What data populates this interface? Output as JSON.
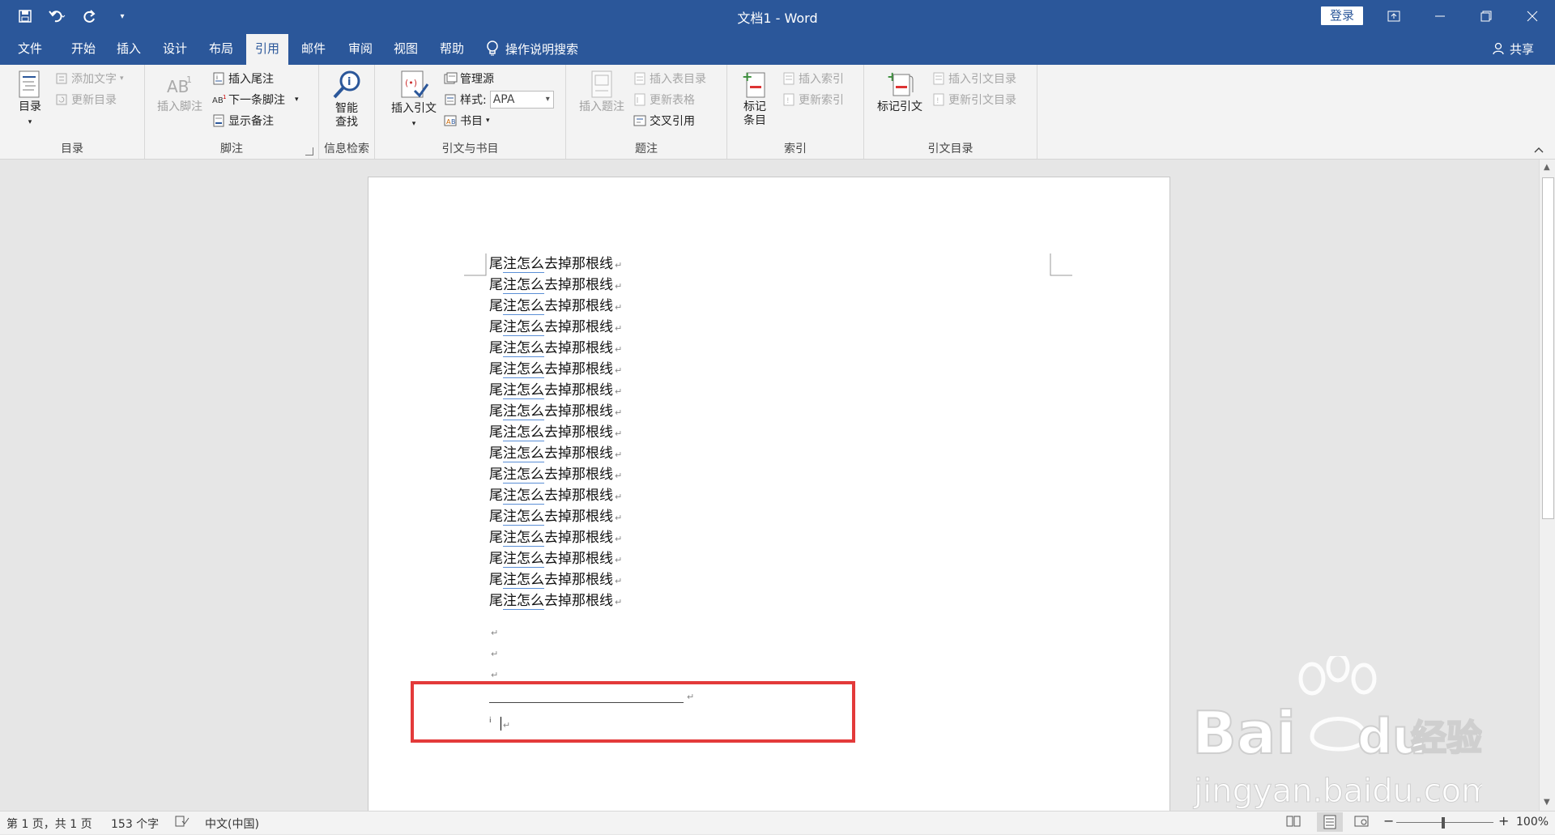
{
  "window": {
    "title": "文档1  -  Word",
    "login": "登录"
  },
  "tabs": [
    {
      "label": "文件"
    },
    {
      "label": "开始"
    },
    {
      "label": "插入"
    },
    {
      "label": "设计"
    },
    {
      "label": "布局"
    },
    {
      "label": "引用"
    },
    {
      "label": "邮件"
    },
    {
      "label": "审阅"
    },
    {
      "label": "视图"
    },
    {
      "label": "帮助"
    }
  ],
  "tab_search": "操作说明搜索",
  "share": "共享",
  "ribbon": {
    "toc": {
      "big": "目录",
      "add_text": "添加文字",
      "update": "更新目录",
      "label": "目录"
    },
    "footnotes": {
      "insert_footnote": "插入脚注",
      "insert_endnote": "插入尾注",
      "next_footnote": "下一条脚注",
      "show_notes": "显示备注",
      "label": "脚注"
    },
    "research": {
      "smart_lookup_1": "智能",
      "smart_lookup_2": "查找",
      "label": "信息检索"
    },
    "citations": {
      "insert_citation": "插入引文",
      "manage_sources": "管理源",
      "style_label": "样式:",
      "style_value": "APA",
      "bibliography": "书目",
      "label": "引文与书目"
    },
    "captions": {
      "insert_caption": "插入题注",
      "insert_table_figures": "插入表目录",
      "update_table": "更新表格",
      "cross_reference": "交叉引用",
      "label": "题注"
    },
    "index": {
      "mark_entry_1": "标记",
      "mark_entry_2": "条目",
      "insert_index": "插入索引",
      "update_index": "更新索引",
      "label": "索引"
    },
    "toa": {
      "mark_citation": "标记引文",
      "insert_toa": "插入引文目录",
      "update_toa": "更新引文目录",
      "label": "引文目录"
    }
  },
  "document": {
    "lines": [
      "尾注怎么去掉那根线",
      "尾注怎么去掉那根线",
      "尾注怎么去掉那根线",
      "尾注怎么去掉那根线",
      "尾注怎么去掉那根线",
      "尾注怎么去掉那根线",
      "尾注怎么去掉那根线",
      "尾注怎么去掉那根线",
      "尾注怎么去掉那根线",
      "尾注怎么去掉那根线",
      "尾注怎么去掉那根线",
      "尾注怎么去掉那根线",
      "尾注怎么去掉那根线",
      "尾注怎么去掉那根线",
      "尾注怎么去掉那根线",
      "尾注怎么去掉那根线",
      "尾注怎么去掉那根线"
    ],
    "line_parts": {
      "a": "尾",
      "b": "注怎么",
      "c": "去掉那根线"
    },
    "paragraph_mark": "↵",
    "endnote_marker": "i"
  },
  "status": {
    "page": "第 1 页，共 1 页",
    "words": "153 个字",
    "language": "中文(中国)",
    "zoom": "100%"
  },
  "watermark": {
    "brand": "Bai",
    "brand2": "du",
    "cn": "经验",
    "url": "jingyan.baidu.com"
  }
}
